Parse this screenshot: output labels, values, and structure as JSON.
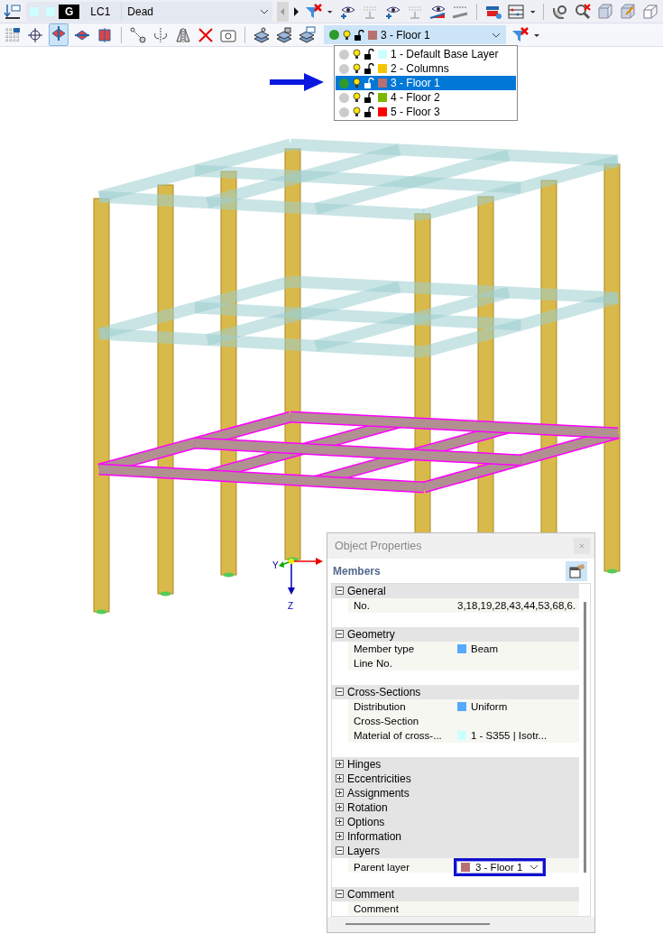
{
  "load_case": {
    "badge": "G",
    "number": "LC1",
    "name": "Dead"
  },
  "layer_selector": {
    "value": "3 - Floor 1",
    "color": "#b87070",
    "active": true
  },
  "layer_list": [
    {
      "label": "1 - Default Base Layer",
      "color": "#ccffff",
      "active": false,
      "selected": false
    },
    {
      "label": "2 - Columns",
      "color": "#f5c400",
      "active": false,
      "selected": false
    },
    {
      "label": "3 - Floor 1",
      "color": "#b87070",
      "active": true,
      "selected": true
    },
    {
      "label": "4 - Floor 2",
      "color": "#7ab800",
      "active": false,
      "selected": false
    },
    {
      "label": "5 - Floor 3",
      "color": "#ff0000",
      "active": false,
      "selected": false
    }
  ],
  "axis_labels": [
    "Y",
    "Z"
  ],
  "properties": {
    "title": "Object Properties",
    "heading": "Members",
    "groups": [
      {
        "label": "General",
        "expanded": true,
        "rows": [
          {
            "label": "No.",
            "kind": "text",
            "value": "3,18,19,28,43,44,53,68,6."
          }
        ]
      },
      {
        "label": "Geometry",
        "expanded": true,
        "rows": [
          {
            "label": "Member type",
            "kind": "text",
            "value": "Beam",
            "color": "#55aaff"
          },
          {
            "label": "Line No.",
            "kind": "text"
          }
        ]
      },
      {
        "label": "Cross-Sections",
        "expanded": true,
        "rows": [
          {
            "label": "Distribution",
            "kind": "text",
            "value": "Uniform",
            "color": "#55aaff"
          },
          {
            "label": "Cross-Section",
            "kind": "text"
          },
          {
            "label": "Material of cross-...",
            "kind": "text",
            "value": "1 - S355 | Isotr...",
            "color": "#ccffff"
          }
        ]
      },
      {
        "label": "Hinges",
        "expanded": false
      },
      {
        "label": "Eccentricities",
        "expanded": false
      },
      {
        "label": "Assignments",
        "expanded": false
      },
      {
        "label": "Rotation",
        "expanded": false
      },
      {
        "label": "Options",
        "expanded": false
      },
      {
        "label": "Information",
        "expanded": false
      },
      {
        "label": "Layers",
        "expanded": true,
        "rows": [
          {
            "label": "Parent layer",
            "kind": "dropdown",
            "value": "3 - Floor 1",
            "color": "#b87070",
            "highlighted": true
          }
        ]
      },
      {
        "label": "Comment",
        "expanded": true,
        "rows": [
          {
            "label": "Comment",
            "kind": "text"
          }
        ]
      }
    ]
  }
}
